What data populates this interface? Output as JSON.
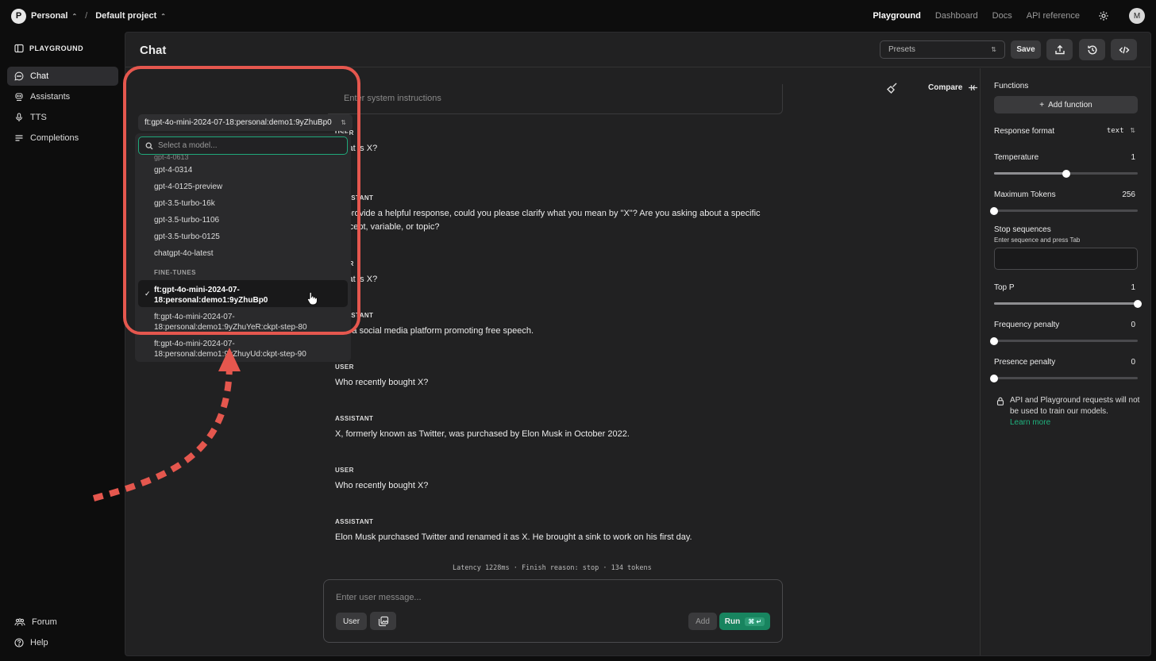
{
  "topbar": {
    "org_initial": "P",
    "org": "Personal",
    "project": "Default project",
    "nav": [
      "Playground",
      "Dashboard",
      "Docs",
      "API reference"
    ],
    "user_initial": "M"
  },
  "sidebar": {
    "title": "PLAYGROUND",
    "items": [
      {
        "label": "Chat",
        "icon": "chat-icon"
      },
      {
        "label": "Assistants",
        "icon": "assistant-icon"
      },
      {
        "label": "TTS",
        "icon": "microphone-icon"
      },
      {
        "label": "Completions",
        "icon": "lines-icon"
      }
    ],
    "bottom": [
      {
        "label": "Forum",
        "icon": "people-icon"
      },
      {
        "label": "Help",
        "icon": "help-icon"
      }
    ]
  },
  "header": {
    "title": "Chat",
    "presets_placeholder": "Presets",
    "save_label": "Save"
  },
  "model_picker": {
    "selected": "ft:gpt-4o-mini-2024-07-18:personal:demo1:9yZhuBp0",
    "search_placeholder": "Select a model...",
    "clipped_item": "gpt-4-0613",
    "models": [
      "gpt-4-0314",
      "gpt-4-0125-preview",
      "gpt-3.5-turbo-16k",
      "gpt-3.5-turbo-1106",
      "gpt-3.5-turbo-0125",
      "chatgpt-4o-latest"
    ],
    "group_label": "FINE-TUNES",
    "fine_tunes": [
      {
        "line1": "ft:gpt-4o-mini-2024-07-",
        "line2": "18:personal:demo1:9yZhuBp0"
      },
      {
        "line1": "ft:gpt-4o-mini-2024-07-",
        "line2": "18:personal:demo1:9yZhuYeR:ckpt-step-80"
      },
      {
        "line1": "ft:gpt-4o-mini-2024-07-",
        "line2": "18:personal:demo1:9yZhuyUd:ckpt-step-90"
      }
    ]
  },
  "system": {
    "partial_placeholder": "Enter system instructions"
  },
  "compare_label": "Compare",
  "messages": [
    {
      "role": "USER",
      "text": "What is X?"
    },
    {
      "role": "ASSISTANT",
      "text": "To provide a helpful response, could you please clarify what you mean by \"X\"? Are you asking about a specific concept, variable, or topic?"
    },
    {
      "role": "USER",
      "text": "What is X?"
    },
    {
      "role": "ASSISTANT",
      "text": "X is a social media platform promoting free speech."
    },
    {
      "role": "USER",
      "text": "Who recently bought X?"
    },
    {
      "role": "ASSISTANT",
      "text": "X, formerly known as Twitter, was purchased by Elon Musk in October 2022."
    },
    {
      "role": "USER",
      "text": "Who recently bought X?"
    },
    {
      "role": "ASSISTANT",
      "text": "Elon Musk purchased Twitter and renamed it as X.  He brought a sink to work on his first day."
    }
  ],
  "latency": "Latency 1228ms · Finish reason: stop · 134 tokens",
  "composer": {
    "placeholder": "Enter user message...",
    "role_label": "User",
    "add_label": "Add",
    "run_label": "Run",
    "run_shortcut": "⌘ ↵"
  },
  "settings": {
    "functions_label": "Functions",
    "add_function_label": "Add function",
    "response_format_label": "Response format",
    "response_format_value": "text",
    "temperature": {
      "label": "Temperature",
      "value": "1",
      "fraction": 0.5
    },
    "max_tokens": {
      "label": "Maximum Tokens",
      "value": "256",
      "fraction": 0.0
    },
    "stop_sequences": {
      "label": "Stop sequences",
      "hint": "Enter sequence and press Tab"
    },
    "top_p": {
      "label": "Top P",
      "value": "1",
      "fraction": 1.0
    },
    "frequency_penalty": {
      "label": "Frequency penalty",
      "value": "0",
      "fraction": 0.0
    },
    "presence_penalty": {
      "label": "Presence penalty",
      "value": "0",
      "fraction": 0.0
    },
    "privacy_text": "API and Playground requests will not be used to train our models.",
    "privacy_link": "Learn more"
  },
  "colors": {
    "accent_green": "#18845f",
    "annotation_red": "#e5574e"
  }
}
